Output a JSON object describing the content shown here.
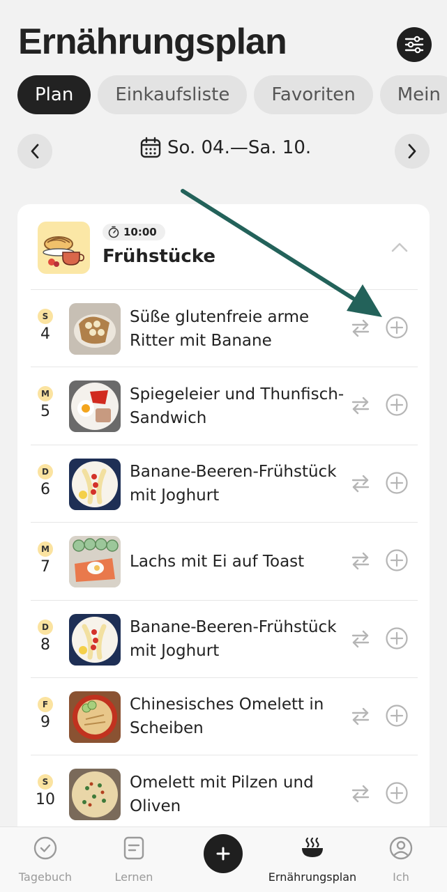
{
  "header": {
    "title": "Ernährungsplan",
    "settings_icon": "sliders-icon"
  },
  "tabs": [
    {
      "label": "Plan",
      "active": true
    },
    {
      "label": "Einkaufsliste",
      "active": false
    },
    {
      "label": "Favoriten",
      "active": false
    },
    {
      "label": "Mein",
      "active": false
    }
  ],
  "week": {
    "label": "So. 04.—Sa. 10."
  },
  "meal": {
    "time": "10:00",
    "name": "Frühstücke"
  },
  "rows": [
    {
      "day_letter": "S",
      "day_num": "4",
      "title": "Süße glutenfreie arme Ritter mit Banane"
    },
    {
      "day_letter": "M",
      "day_num": "5",
      "title": "Spiegeleier und Thunfisch-Sandwich"
    },
    {
      "day_letter": "D",
      "day_num": "6",
      "title": "Banane-Beeren-Frühstück mit Joghurt"
    },
    {
      "day_letter": "M",
      "day_num": "7",
      "title": "Lachs mit Ei auf Toast"
    },
    {
      "day_letter": "D",
      "day_num": "8",
      "title": "Banane-Beeren-Frühstück mit Joghurt"
    },
    {
      "day_letter": "F",
      "day_num": "9",
      "title": "Chinesisches Omelett in Scheiben"
    },
    {
      "day_letter": "S",
      "day_num": "10",
      "title": "Omelett mit Pilzen und Oliven"
    }
  ],
  "bottom_nav": {
    "tagebuch": "Tagebuch",
    "lernen": "Lernen",
    "plan": "Ernährungsplan",
    "ich": "Ich"
  },
  "colors": {
    "accent_dark": "#1f1f1f",
    "badge": "#fbe3a0",
    "annotation_arrow": "#23625a"
  }
}
